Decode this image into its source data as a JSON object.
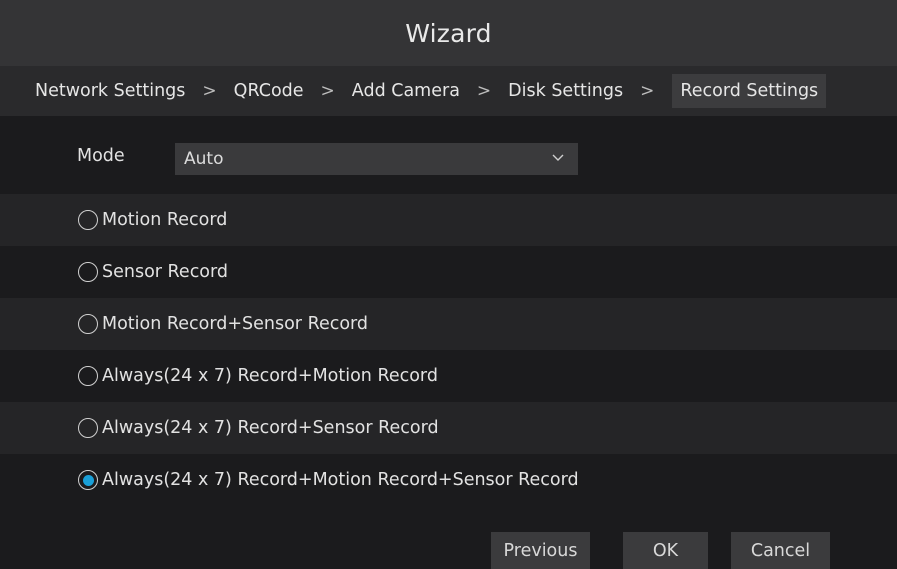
{
  "window": {
    "title": "Wizard"
  },
  "steps": [
    {
      "label": "Network Settings"
    },
    {
      "label": "QRCode"
    },
    {
      "label": "Add Camera"
    },
    {
      "label": "Disk Settings"
    },
    {
      "label": "Record Settings",
      "active": true
    }
  ],
  "separator_glyph": ">",
  "mode": {
    "label": "Mode",
    "selected": "Auto",
    "icon": "chevron-down-icon"
  },
  "options": [
    {
      "label": "Motion Record",
      "checked": false
    },
    {
      "label": "Sensor Record",
      "checked": false
    },
    {
      "label": "Motion Record+Sensor Record",
      "checked": false
    },
    {
      "label": "Always(24 x 7) Record+Motion Record",
      "checked": false
    },
    {
      "label": "Always(24 x 7) Record+Sensor Record",
      "checked": false
    },
    {
      "label": "Always(24 x 7) Record+Motion Record+Sensor Record",
      "checked": true
    }
  ],
  "buttons": {
    "previous": "Previous",
    "ok": "OK",
    "cancel": "Cancel"
  },
  "colors": {
    "accent": "#1aa0d8",
    "background": "#1b1b1d",
    "titlebar": "#343436"
  }
}
